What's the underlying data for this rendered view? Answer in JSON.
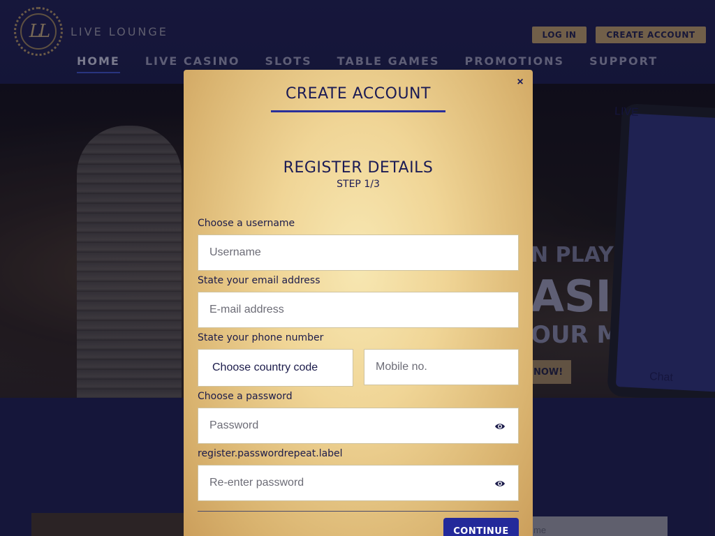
{
  "brand": {
    "logo_initials": "LL",
    "name": "LIVE LOUNGE"
  },
  "header": {
    "login_label": "LOG IN",
    "create_account_label": "CREATE ACCOUNT",
    "nav": [
      {
        "label": "HOME",
        "active": true
      },
      {
        "label": "LIVE CASINO"
      },
      {
        "label": "SLOTS"
      },
      {
        "label": "TABLE GAMES"
      },
      {
        "label": "PROMOTIONS"
      },
      {
        "label": "SUPPORT"
      }
    ]
  },
  "hero": {
    "line1": "N PLAY",
    "line2": "ASINO",
    "line3": "OUR MOBILE!",
    "cta": "NOW!",
    "phone_label": "LIVE",
    "phone_chat": "Chat"
  },
  "lower": {
    "input_fragment": "me"
  },
  "modal": {
    "close_symbol": "×",
    "title": "CREATE ACCOUNT",
    "section_title": "REGISTER DETAILS",
    "step": "STEP 1/3",
    "username": {
      "label": "Choose a username",
      "placeholder": "Username"
    },
    "email": {
      "label": "State your email address",
      "placeholder": "E-mail address"
    },
    "phone": {
      "label": "State your phone number",
      "country_code": "Choose country code",
      "mobile_placeholder": "Mobile no."
    },
    "password": {
      "label": "Choose a password",
      "placeholder": "Password"
    },
    "password_repeat": {
      "label": "register.passwordrepeat.label",
      "placeholder": "Re-enter password"
    },
    "continue_label": "CONTINUE"
  },
  "colors": {
    "navy": "#1b1b55",
    "accent_blue": "#23299a",
    "gold_button": "#a88c5d"
  }
}
